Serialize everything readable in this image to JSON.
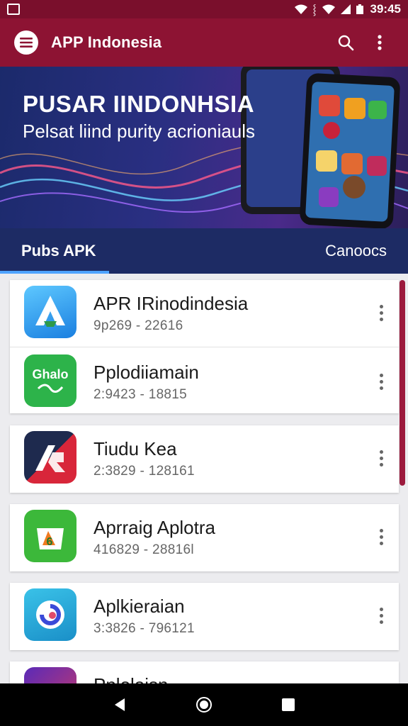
{
  "status_bar": {
    "time": "39:45",
    "icons": [
      "notification-icon",
      "wifi-icon",
      "vibrate-icon",
      "signal-icon",
      "battery-icon"
    ]
  },
  "app_bar": {
    "title": "APP Indonesia",
    "menu_icon": "menu-icon",
    "search_icon": "search-icon",
    "more_icon": "more-vert-icon",
    "color": "#8d1333"
  },
  "hero": {
    "title": "PUSAR IINDONHSIA",
    "subtitle": "Pelsat liind purity acrioniauls"
  },
  "tabs": [
    {
      "label": "Pubs APK",
      "active": true
    },
    {
      "label": "Canoocs",
      "active": false
    }
  ],
  "apps": [
    {
      "name": "APR IRinodindesia",
      "meta": "9p269 - 22616",
      "icon": "arrow-a-icon"
    },
    {
      "name": "Pplodiiamain",
      "meta": "2:9423 - 18815",
      "icon": "green-chat-icon"
    },
    {
      "name": "Tiudu Kea",
      "meta": "2:3829 - 128161",
      "icon": "red-play-icon"
    },
    {
      "name": "Aprraig Aplotra",
      "meta": "416829 - 28816l",
      "icon": "green-bag-icon"
    },
    {
      "name": "Aplkieraian",
      "meta": "3:3826 - 796121",
      "icon": "blue-swirl-icon"
    },
    {
      "name": "Pplolaisn",
      "meta": "",
      "icon": "purple-app-icon"
    }
  ],
  "nav_bar": {
    "icons": [
      "back-icon",
      "home-icon",
      "recents-icon"
    ]
  }
}
